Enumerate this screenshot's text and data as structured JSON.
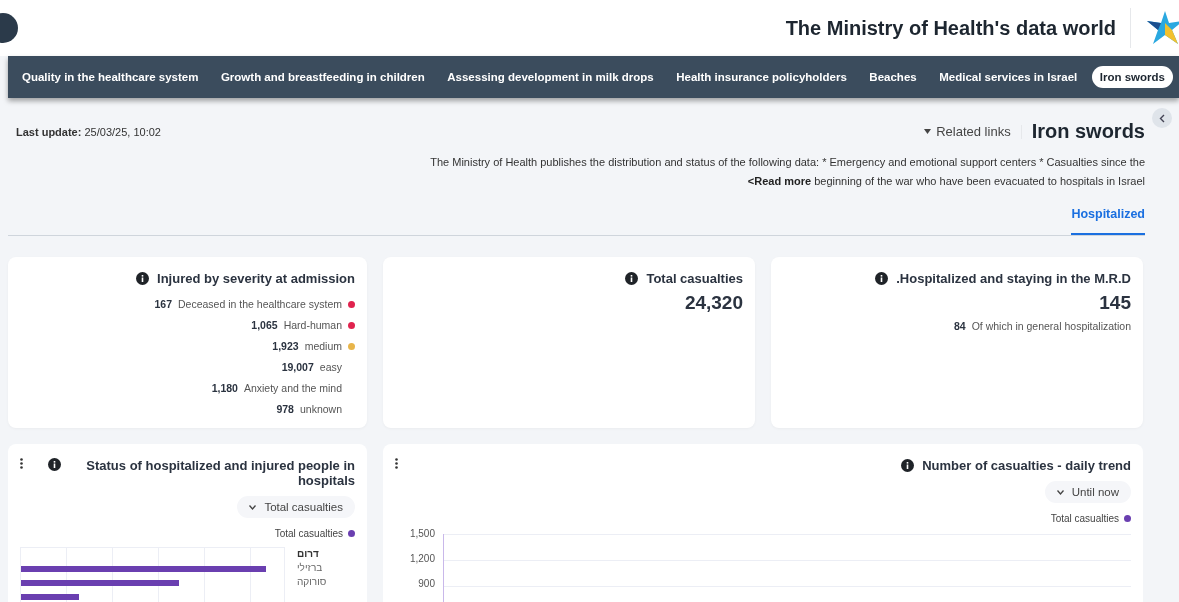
{
  "header": {
    "title": "The Ministry of Health's data world"
  },
  "nav": [
    {
      "label": "Quality in the healthcare system",
      "selected": false
    },
    {
      "label": "Growth and breastfeeding in children",
      "selected": false
    },
    {
      "label": "Assessing development in milk drops",
      "selected": false
    },
    {
      "label": "Health insurance policyholders",
      "selected": false
    },
    {
      "label": "Beaches",
      "selected": false
    },
    {
      "label": "Medical services in Israel",
      "selected": false
    },
    {
      "label": "Iron swords",
      "selected": true
    }
  ],
  "intro": {
    "last_update_label": "Last update:",
    "last_update": "25/03/25, 10:02",
    "related_links": "Related links",
    "page_title": "Iron swords",
    "description_1": "The Ministry of Health publishes the distribution and status of the following data: * Emergency and emotional support centers * Casualties since the",
    "read_more": "<Read more",
    "description_2": "beginning of the war who have been evacuated to hospitals in Israel"
  },
  "subtabs": [
    {
      "label": "Hospitalized",
      "selected": true
    }
  ],
  "severity_card": {
    "title": "Injured by severity at admission",
    "rows": [
      {
        "value": "167",
        "label": "Deceased in the healthcare system",
        "color": "#e0234e"
      },
      {
        "value": "1,065",
        "label": "Hard-human",
        "color": "#e0234e"
      },
      {
        "value": "1,923",
        "label": "medium",
        "color": "#e8b54a"
      },
      {
        "value": "19,007",
        "label": "easy"
      },
      {
        "value": "1,180",
        "label": "Anxiety and the mind"
      },
      {
        "value": "978",
        "label": "unknown"
      }
    ]
  },
  "total_card": {
    "title": "Total casualties",
    "value": "24,320"
  },
  "hospitalized_card": {
    "title": ".Hospitalized and staying in the M.R.D",
    "value": "145",
    "sub_value": "84",
    "sub_label": "Of which in general hospitalization"
  },
  "status_card": {
    "title": "Status of hospitalized and injured people in hospitals",
    "dropdown": "Total casualties",
    "legend": "Total casualties",
    "group": "דרום",
    "bars": [
      {
        "label": "ברזילי",
        "level": 0.93
      },
      {
        "label": "סורוקה",
        "level": 0.6
      },
      {
        "level": 0.22
      }
    ]
  },
  "trend_card": {
    "title": "Number of casualties - daily trend",
    "dropdown": "Until now",
    "legend": "Total casualties",
    "y_ticks": [
      "1,500",
      "1,200",
      "900"
    ]
  }
}
